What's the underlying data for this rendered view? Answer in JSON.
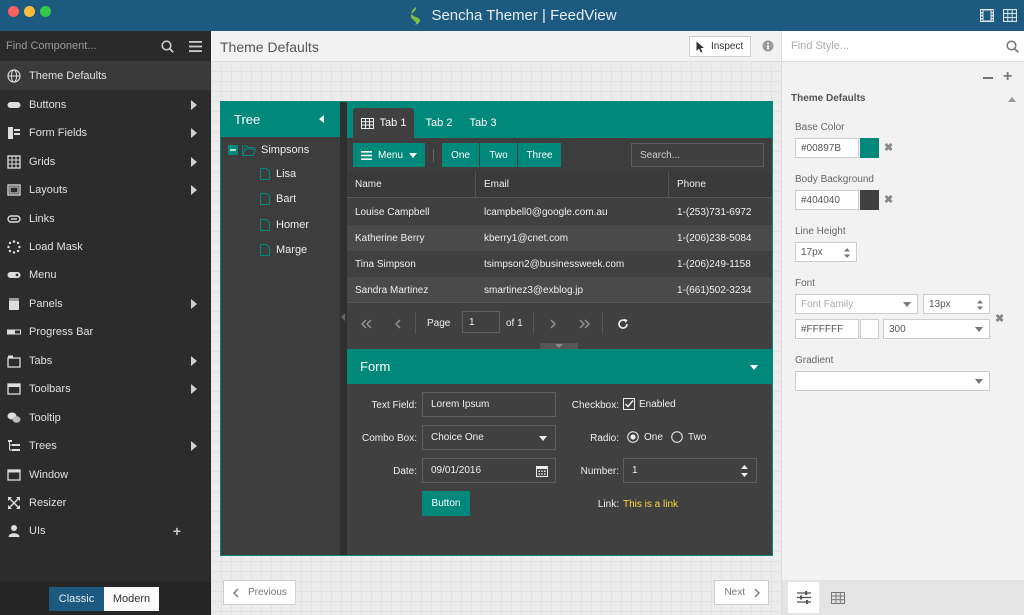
{
  "window": {
    "title": "Sencha Themer | FeedView",
    "traffic_colors": [
      "#fc605c",
      "#fdbc40",
      "#34c84a"
    ],
    "bar_color": "#1d5a80"
  },
  "sidebar": {
    "search_placeholder": "Find Component...",
    "items": [
      {
        "label": "Theme Defaults",
        "icon": "globe-icon",
        "arrow": false
      },
      {
        "label": "Buttons",
        "icon": "button-icon",
        "arrow": true
      },
      {
        "label": "Form Fields",
        "icon": "form-fields-icon",
        "arrow": true
      },
      {
        "label": "Grids",
        "icon": "grid-icon",
        "arrow": true
      },
      {
        "label": "Layouts",
        "icon": "layout-icon",
        "arrow": true
      },
      {
        "label": "Links",
        "icon": "link-icon",
        "arrow": false
      },
      {
        "label": "Load Mask",
        "icon": "spinner-icon",
        "arrow": false
      },
      {
        "label": "Menu",
        "icon": "menu-icon",
        "arrow": false
      },
      {
        "label": "Panels",
        "icon": "panel-icon",
        "arrow": true
      },
      {
        "label": "Progress Bar",
        "icon": "progress-bar-icon",
        "arrow": false
      },
      {
        "label": "Tabs",
        "icon": "tabs-icon",
        "arrow": true
      },
      {
        "label": "Toolbars",
        "icon": "toolbar-icon",
        "arrow": true
      },
      {
        "label": "Tooltip",
        "icon": "tooltip-icon",
        "arrow": false
      },
      {
        "label": "Trees",
        "icon": "tree-icon",
        "arrow": true
      },
      {
        "label": "Window",
        "icon": "window-icon",
        "arrow": false
      },
      {
        "label": "Resizer",
        "icon": "resizer-icon",
        "arrow": false
      },
      {
        "label": "UIs",
        "icon": "user-icon",
        "arrow": false
      }
    ],
    "toolkit": {
      "classic": "Classic",
      "modern": "Modern",
      "selected": "Classic"
    }
  },
  "main": {
    "title": "Theme Defaults",
    "inspect_label": "Inspect",
    "previous_label": "Previous",
    "next_label": "Next"
  },
  "preview": {
    "tree": {
      "title": "Tree",
      "root": "Simpsons",
      "children": [
        "Lisa",
        "Bart",
        "Homer",
        "Marge"
      ]
    },
    "tabs": [
      "Tab 1",
      "Tab 2",
      "Tab 3"
    ],
    "toolbar": {
      "menu_label": "Menu",
      "segments": [
        "One",
        "Two",
        "Three"
      ],
      "search_placeholder": "Search..."
    },
    "grid": {
      "columns": [
        "Name",
        "Email",
        "Phone"
      ],
      "rows": [
        [
          "Louise Campbell",
          "lcampbell0@google.com.au",
          "1-(253)731-6972"
        ],
        [
          "Katherine Berry",
          "kberry1@cnet.com",
          "1-(206)238-5084"
        ],
        [
          "Tina Simpson",
          "tsimpson2@businessweek.com",
          "1-(206)249-1158"
        ],
        [
          "Sandra Martinez",
          "smartinez3@exblog.jp",
          "1-(661)502-3234"
        ]
      ]
    },
    "pager": {
      "page_label": "Page",
      "page_value": "1",
      "of_label": "of 1"
    },
    "form": {
      "title": "Form",
      "text_field_label": "Text Field:",
      "text_field_value": "Lorem Ipsum",
      "checkbox_label": "Checkbox:",
      "checkbox_text": "Enabled",
      "combo_label": "Combo Box:",
      "combo_value": "Choice One",
      "radio_label": "Radio:",
      "radio_one": "One",
      "radio_two": "Two",
      "date_label": "Date:",
      "date_value": "09/01/2016",
      "number_label": "Number:",
      "number_value": "1",
      "button_label": "Button",
      "link_label": "Link:",
      "link_text": "This is a link"
    }
  },
  "style_panel": {
    "search_placeholder": "Find Style...",
    "section_title": "Theme Defaults",
    "base_color_label": "Base Color",
    "base_color_value": "#00897B",
    "body_bg_label": "Body Background",
    "body_bg_value": "#404040",
    "line_height_label": "Line Height",
    "line_height_value": "17px",
    "font_label": "Font",
    "font_family_placeholder": "Font Family",
    "font_size_value": "13px",
    "font_color_value": "#FFFFFF",
    "font_weight_value": "300",
    "gradient_label": "Gradient",
    "gradient_value": ""
  },
  "colors": {
    "accent": "#00897b",
    "link": "#ffd740"
  }
}
